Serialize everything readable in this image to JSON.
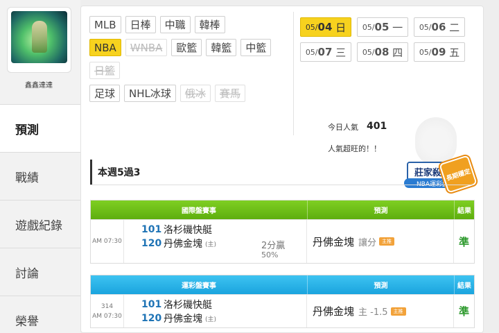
{
  "user": {
    "name": "鑫鑫達達"
  },
  "menu": {
    "items": [
      "預測",
      "戰績",
      "遊戲紀錄",
      "討論",
      "榮譽"
    ]
  },
  "tags": {
    "row1": [
      "MLB",
      "日棒",
      "中職",
      "韓棒"
    ],
    "row2": [
      "NBA",
      "WNBA",
      "歐籃",
      "韓籃",
      "中籃"
    ],
    "row3": [
      "日籃"
    ],
    "row4": [
      "足球",
      "NHL冰球",
      "俄冰",
      "賽馬"
    ]
  },
  "dates": [
    {
      "md": "05/",
      "d": "04",
      "w": "日"
    },
    {
      "md": "05/",
      "d": "05",
      "w": "一"
    },
    {
      "md": "05/",
      "d": "06",
      "w": "二"
    },
    {
      "md": "05/",
      "d": "07",
      "w": "三"
    },
    {
      "md": "05/",
      "d": "08",
      "w": "四"
    },
    {
      "md": "05/",
      "d": "09",
      "w": "五"
    }
  ],
  "popularity": {
    "label": "今日人氣",
    "value": "401",
    "note": "人氣超旺的！！"
  },
  "badge": {
    "title": "莊家殺手",
    "sub": "NBA運彩盤",
    "seal": "長期穩定"
  },
  "week_record": "本週5過3",
  "table1": {
    "headers": [
      "國際盤賽事",
      "預測",
      "結果"
    ],
    "time": [
      "",
      "AM 07:30"
    ],
    "teams": [
      {
        "no": "101",
        "name": "洛杉磯快艇",
        "home": ""
      },
      {
        "no": "120",
        "name": "丹佛金塊",
        "home": "(主)"
      }
    ],
    "odds": [
      "2分贏",
      "50%"
    ],
    "pick": "丹佛金塊",
    "pick_extra": "讓分",
    "pick_icon": "主推",
    "result": "準"
  },
  "table2": {
    "headers": [
      "運彩盤賽事",
      "預測",
      "結果"
    ],
    "time": [
      "314",
      "AM 07:30"
    ],
    "teams": [
      {
        "no": "101",
        "name": "洛杉磯快艇",
        "home": ""
      },
      {
        "no": "120",
        "name": "丹佛金塊",
        "home": "(主)"
      }
    ],
    "pick": "丹佛金塊",
    "pick_extra": "主 -1.5",
    "pick_icon": "主推",
    "result": "準"
  }
}
